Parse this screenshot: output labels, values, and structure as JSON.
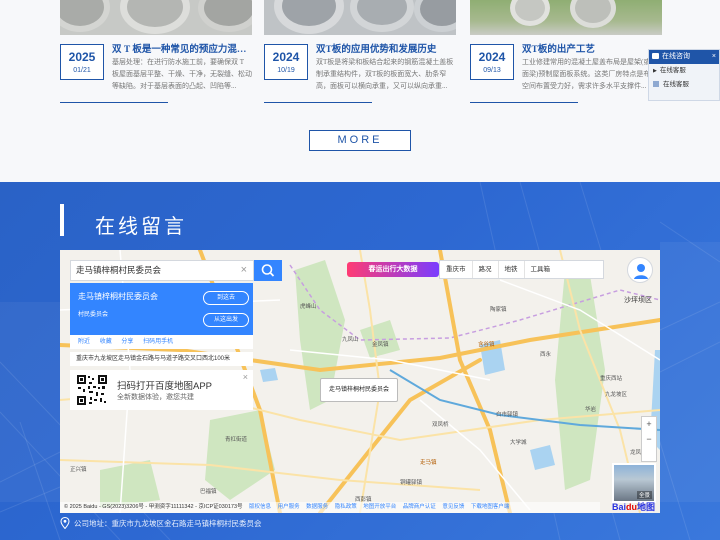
{
  "news": {
    "cards": [
      {
        "year": "2025",
        "monthday": "01/21",
        "title": "双 T 板是一种常见的预应力混凝...",
        "desc": "基层处理：在进行防水施工前，要确保双 T 板屋面基层平整、干燥、干净，无裂缝、松动等缺陷。对于基层表面的凸起、凹陷等..."
      },
      {
        "year": "2024",
        "monthday": "10/19",
        "title": "双T板的应用优势和发展历史",
        "desc": "双T板是将梁和板结合起来的钢筋混凝土盖板制承重结构件，双T板的板面宽大、肋条窄高，面板可以横向承重，又可以纵向承重..."
      },
      {
        "year": "2024",
        "monthday": "09/13",
        "title": "双T板的出产工艺",
        "desc": "工业修建常用的混凝土屋盖布局是屋架(或屋面梁)预制屋面板系统。这类厂房特点是布局空间布置受力好，需求许多水平支撑件..."
      }
    ],
    "more_label": "MORE"
  },
  "consult": {
    "title": "在线咨询",
    "close": "×",
    "items": [
      "在线客服",
      "在线客服"
    ]
  },
  "section": {
    "title": "在线留言",
    "address": "公司地址：重庆市九龙坡区金石路走马镇梓桐村民委员会"
  },
  "map": {
    "search_value": "走马镇梓桐村民委员会",
    "clear_icon": "×",
    "poi_name": "走马镇梓桐村民委员会",
    "poi_type": "村民委员会",
    "btn_goto": "到这去",
    "btn_from": "从这出发",
    "actions": [
      "附近",
      "收藏",
      "分享",
      "扫码用手机"
    ],
    "address": "重庆市九龙坡区走马镇金石路与马道子路交叉口西北100米",
    "qr_title": "扫码打开百度地图APP",
    "qr_subtitle": "全新数据体验，邀您共建",
    "qr_close": "×",
    "marker_label": "走马镇梓桐村民委员会",
    "promo": "春运出行大数据",
    "toolbar": [
      "重庆市",
      "路况",
      "地铁",
      "工具箱"
    ],
    "zoom_in": "+",
    "zoom_out": "−",
    "street_label": "全景",
    "copyright": "© 2025 Baidu - GS(2023)3206号 - 甲测资字11111342 - 京ICP证030173号",
    "copyright_links": [
      "版权信息",
      "用户服务",
      "数据服务",
      "隐私政策",
      "地图开放平台",
      "品牌商户认证",
      "意见反馈",
      "下载地图客户端"
    ],
    "logo_a": "Bai",
    "logo_b": "du",
    "logo_c": "地图",
    "labels": [
      "虎峰山",
      "九凤山",
      "含谷镇",
      "走马镇",
      "金凤镇",
      "西永",
      "沙坪坝区",
      "陶家镇",
      "白市驿镇",
      "铜罐驿镇",
      "西彭镇",
      "巴福镇",
      "华岩",
      "青杠街道",
      "正兴镇",
      "龙凤桥",
      "九龙坡区",
      "重庆西站",
      "大学城",
      "双凤桥"
    ]
  },
  "colors": {
    "brand": "#1f55a8",
    "section_bg": "#2d68d2",
    "map_accent": "#3385ff"
  }
}
